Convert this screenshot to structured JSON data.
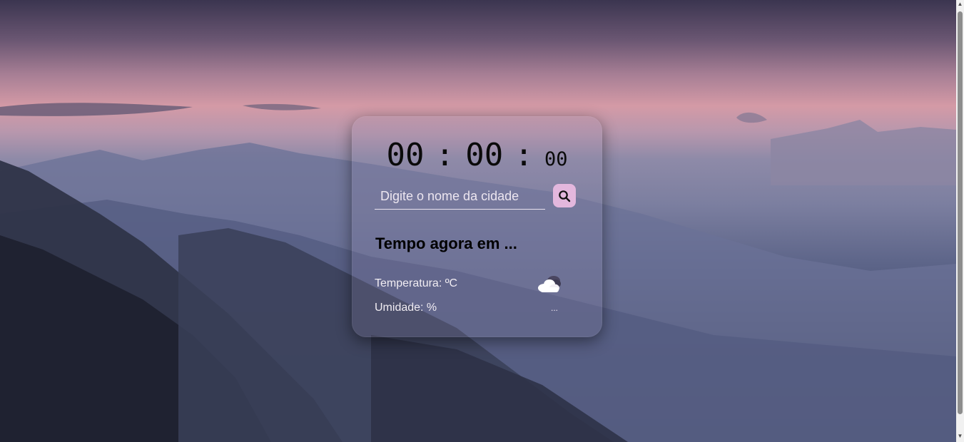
{
  "clock": {
    "hours": "00",
    "minutes": "00",
    "seconds": "00",
    "separator": ":"
  },
  "search": {
    "placeholder": "Digite o nome da cidade",
    "value": "",
    "button_icon": "search-icon"
  },
  "weather": {
    "heading": "Tempo agora em ...",
    "temperature_label": "Temperatura: ºC",
    "humidity_label": "Umidade: %",
    "icon": "cloud-icon",
    "description": "..."
  },
  "colors": {
    "accent": "#e3b7dd",
    "card_text": "#000000"
  }
}
